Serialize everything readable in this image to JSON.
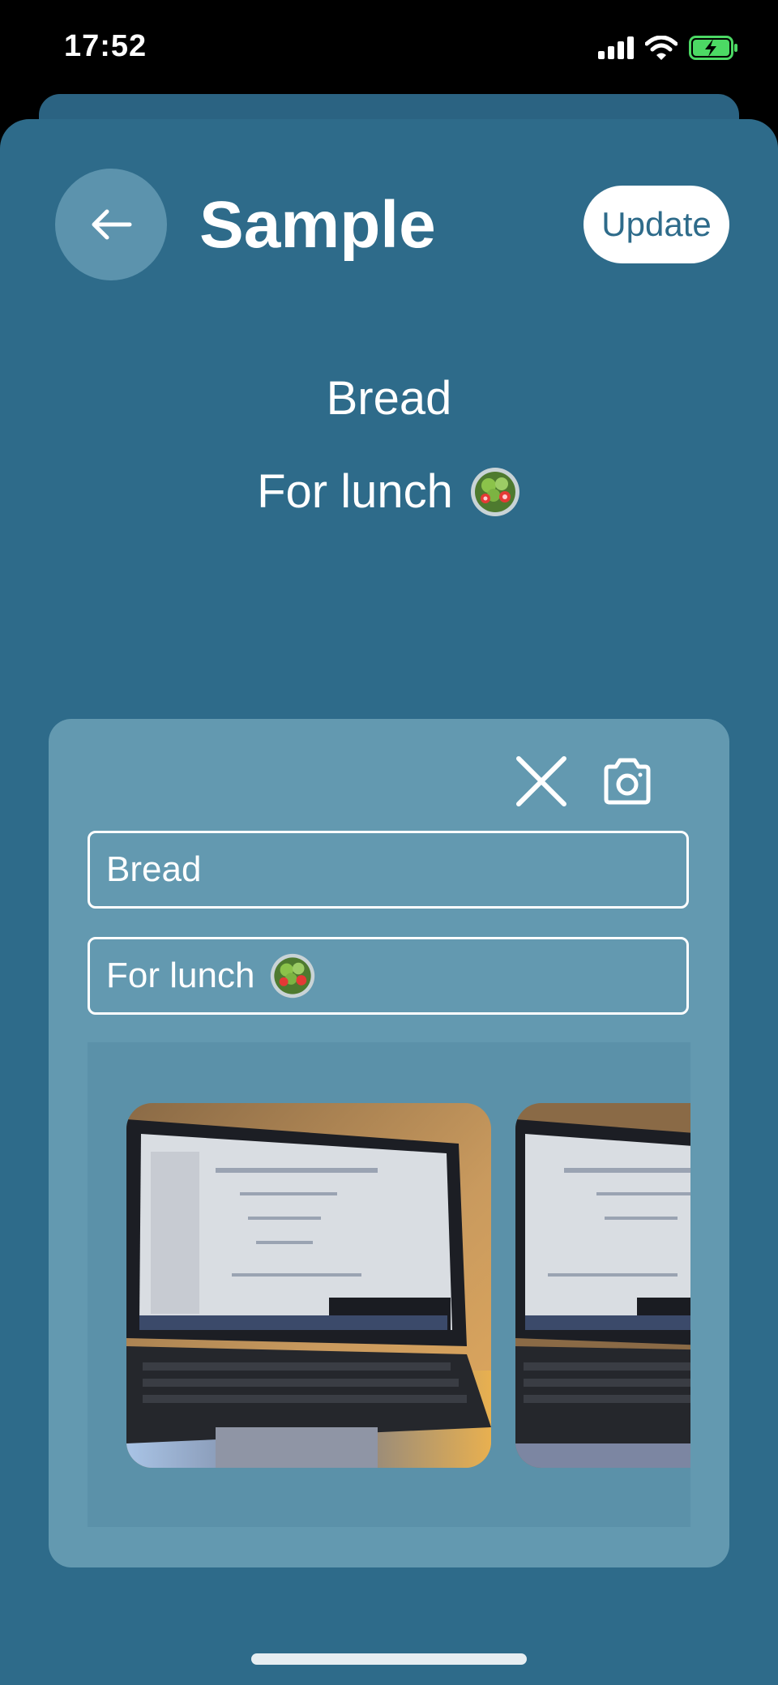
{
  "status_bar": {
    "time": "17:52"
  },
  "header": {
    "title": "Sample",
    "update_label": "Update"
  },
  "item": {
    "name": "Bread",
    "description": "For lunch"
  },
  "form": {
    "name_value": "Bread",
    "description_value": "For lunch"
  },
  "icons": {
    "back": "arrow-left-icon",
    "close": "close-icon",
    "camera": "camera-icon",
    "emoji": "salad-emoji"
  },
  "colors": {
    "background": "#2e6b8a",
    "card": "#6399b0",
    "back_button": "#5c93ad",
    "accent_text": "#2e6b8a"
  }
}
